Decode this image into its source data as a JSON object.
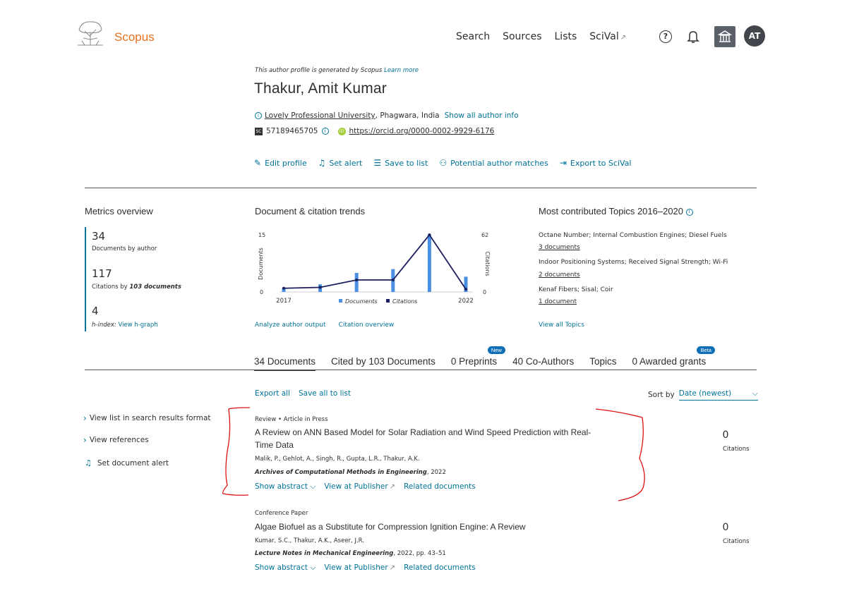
{
  "header": {
    "brand": "Scopus",
    "nav": [
      {
        "label": "Search"
      },
      {
        "label": "Sources"
      },
      {
        "label": "Lists"
      },
      {
        "label": "SciVal",
        "external": true
      }
    ],
    "help_icon": "question-circle-icon",
    "bell_icon": "bell-icon",
    "institution_icon": "institution-icon",
    "avatar_initials": "AT"
  },
  "profile": {
    "generated_note": "This author profile is generated by Scopus",
    "learn_more": "Learn more",
    "name": "Thakur, Amit Kumar",
    "affiliation": "Lovely Professional University",
    "location": ", Phagwara, India",
    "show_all_info": "Show all author info",
    "scopus_id": "57189465705",
    "orcid": "https://orcid.org/0000-0002-9929-6176",
    "actions": [
      {
        "label": "Edit profile",
        "icon": "pencil-icon"
      },
      {
        "label": "Set alert",
        "icon": "bell-icon"
      },
      {
        "label": "Save to list",
        "icon": "list-icon"
      },
      {
        "label": "Potential author matches",
        "icon": "people-icon"
      },
      {
        "label": "Export to SciVal",
        "icon": "export-icon"
      }
    ]
  },
  "metrics": {
    "title": "Metrics overview",
    "documents_value": "34",
    "documents_label": "Documents by author",
    "citations_value": "117",
    "citations_label_pre": "Citations by ",
    "citations_label_bold": "103 documents",
    "hindex_value": "4",
    "hindex_label": "h-index:",
    "hindex_link": "View h-graph"
  },
  "trends": {
    "title": "Document & citation trends",
    "analyze_link": "Analyze author output",
    "citation_link": "Citation overview"
  },
  "chart_data": {
    "type": "bar",
    "categories": [
      "2017",
      "2018",
      "2019",
      "2020",
      "2021",
      "2022"
    ],
    "series": [
      {
        "name": "Documents",
        "type": "bar",
        "axis": "left",
        "values": [
          1,
          2,
          5,
          6,
          15,
          4
        ]
      },
      {
        "name": "Citations",
        "type": "line",
        "axis": "right",
        "values": [
          4,
          5,
          13,
          13,
          62,
          3
        ]
      }
    ],
    "ylabel_left": "Documents",
    "ylabel_right": "Citations",
    "ylim_left": [
      0,
      15
    ],
    "ylim_right": [
      0,
      62
    ],
    "left_ticks": [
      "15",
      "0"
    ],
    "right_ticks": [
      "62",
      "0"
    ],
    "x_tick_labels": [
      "2017",
      "2022"
    ],
    "legend_position": "bottom",
    "colors": {
      "documents": "#4b8fe2",
      "citations": "#1b1f5e"
    }
  },
  "topics": {
    "title": "Most contributed Topics 2016–2020",
    "items": [
      {
        "name": "Octane Number; Internal Combustion Engines; Diesel Fuels",
        "docs": "3 documents"
      },
      {
        "name": "Indoor Positioning Systems; Received Signal Strength; Wi-Fi",
        "docs": "2 documents"
      },
      {
        "name": "Kenaf Fibers; Sisal; Coir",
        "docs": "1 document"
      }
    ],
    "view_all": "View all Topics"
  },
  "tabs": [
    {
      "label": "34 Documents",
      "active": true
    },
    {
      "label": "Cited by 103 Documents"
    },
    {
      "label": "0 Preprints",
      "badge": "New"
    },
    {
      "label": "40 Co-Authors"
    },
    {
      "label": "Topics"
    },
    {
      "label": "0 Awarded grants",
      "badge": "Beta"
    }
  ],
  "list": {
    "export_all": "Export all",
    "save_all": "Save all to list",
    "sort_label": "Sort by",
    "sort_value": "Date (newest)"
  },
  "sidebar": {
    "view_list": "View list in search results format",
    "view_refs": "View references",
    "set_alert": "Set document alert"
  },
  "documents": [
    {
      "type": "Review",
      "status": "Article in Press",
      "title": "A Review on ANN Based Model for Solar Radiation and Wind Speed Prediction with Real-Time Data",
      "authors": "Malik, P., Gehlot, A., Singh, R., Gupta, L.R., Thakur, A.K.",
      "source": "Archives of Computational Methods in Engineering",
      "source_rest": ", 2022",
      "citations": "0",
      "citations_label": "Citations",
      "show_abstract": "Show abstract",
      "view_publisher": "View at Publisher",
      "related": "Related documents"
    },
    {
      "type": "Conference Paper",
      "title": "Algae Biofuel as a Substitute for Compression Ignition Engine: A Review",
      "authors": "Kumar, S.C., Thakur, A.K., Aseer, J.R.",
      "source": "Lecture Notes in Mechanical Engineering",
      "source_rest": ", 2022, pp. 43–51",
      "citations": "0",
      "citations_label": "Citations",
      "show_abstract": "Show abstract",
      "view_publisher": "View at Publisher",
      "related": "Related documents"
    }
  ]
}
